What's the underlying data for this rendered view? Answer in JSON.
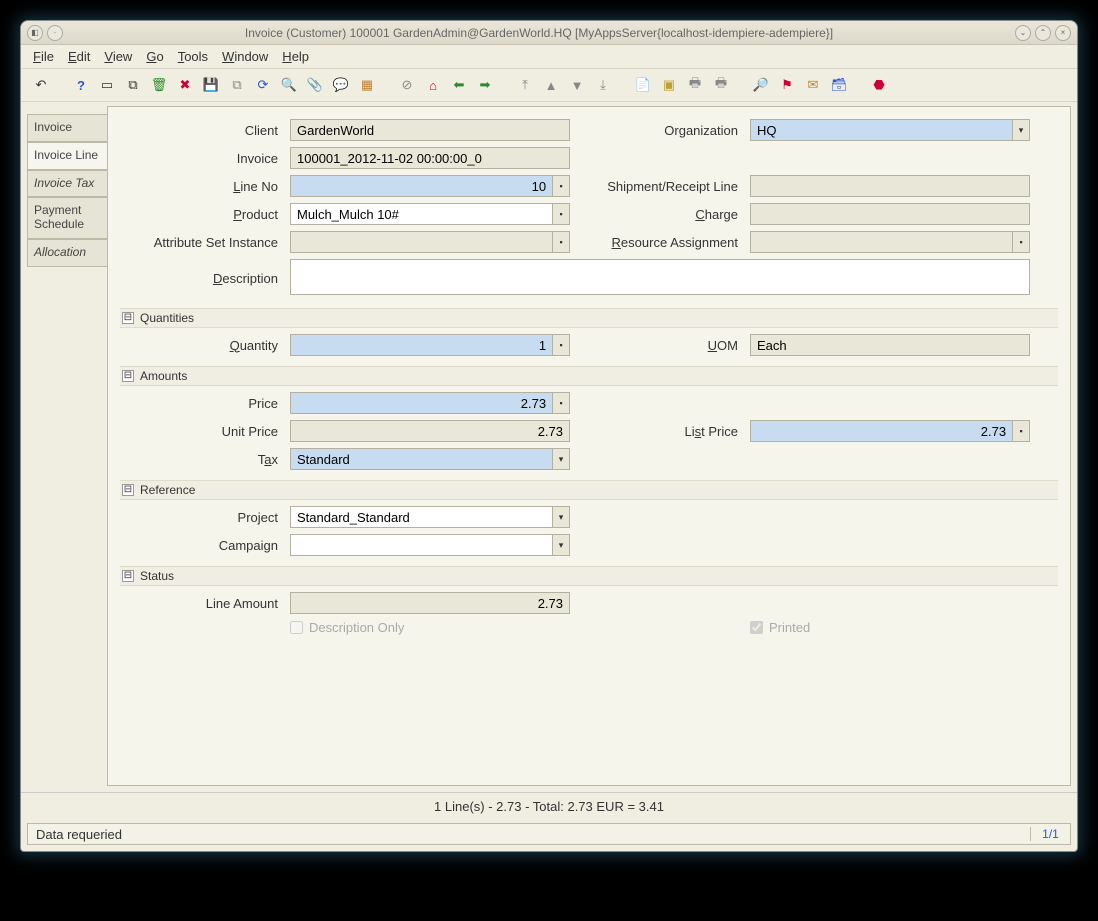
{
  "window": {
    "title": "Invoice (Customer)  100001  GardenAdmin@GardenWorld.HQ [MyAppsServer{localhost-idempiere-adempiere}]"
  },
  "menu": {
    "file": "File",
    "edit": "Edit",
    "view": "View",
    "go": "Go",
    "tools": "Tools",
    "window": "Window",
    "help": "Help"
  },
  "tabs": {
    "invoice": "Invoice",
    "invoice_line": "Invoice Line",
    "invoice_tax": "Invoice Tax",
    "payment_schedule": "Payment Schedule",
    "allocation": "Allocation"
  },
  "labels": {
    "client": "Client",
    "organization": "Organization",
    "invoice": "Invoice",
    "line_no": "Line No",
    "shipment_line": "Shipment/Receipt Line",
    "product": "Product",
    "charge": "Charge",
    "attribute_set": "Attribute Set Instance",
    "resource_assign": "Resource Assignment",
    "description": "Description",
    "quantities": "Quantities",
    "quantity": "Quantity",
    "uom": "UOM",
    "amounts": "Amounts",
    "price": "Price",
    "unit_price": "Unit Price",
    "list_price": "List Price",
    "tax": "Tax",
    "reference": "Reference",
    "project": "Project",
    "campaign": "Campaign",
    "status": "Status",
    "line_amount": "Line Amount",
    "desc_only": "Description Only",
    "printed": "Printed"
  },
  "values": {
    "client": "GardenWorld",
    "organization": "HQ",
    "invoice": "100001_2012-11-02 00:00:00_0",
    "line_no": "10",
    "shipment_line": "",
    "product": "Mulch_Mulch 10#",
    "charge": "",
    "attribute_set": "",
    "resource_assign": "",
    "description": "",
    "quantity": "1",
    "uom": "Each",
    "price": "2.73",
    "unit_price": "2.73",
    "list_price": "2.73",
    "tax": "Standard",
    "project": "Standard_Standard",
    "campaign": "",
    "line_amount": "2.73"
  },
  "summary": "1 Line(s) - 2.73 -  Total: 2.73  EUR  =   3.41",
  "status_left": "Data requeried",
  "status_right": "1/1"
}
